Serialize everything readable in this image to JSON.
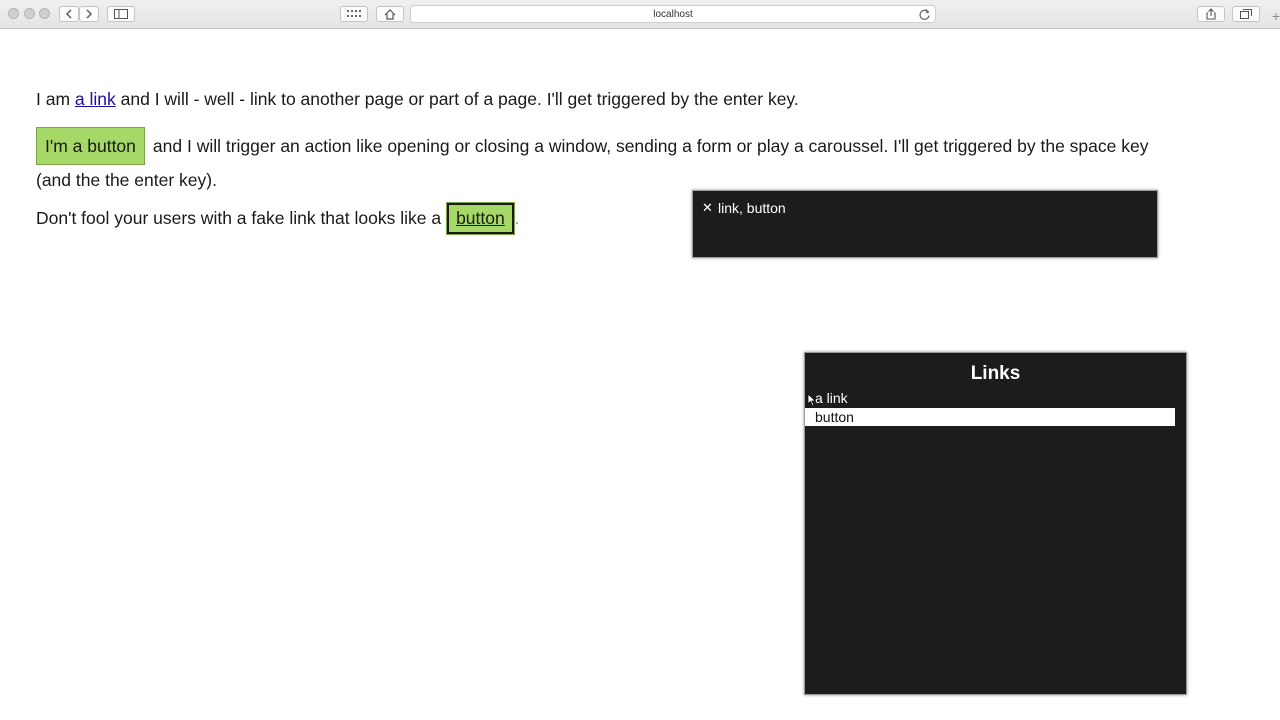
{
  "browser": {
    "url": "localhost",
    "icons": {
      "close": "close-window-dot",
      "minimize": "minimize-window-dot",
      "zoom": "zoom-window-dot",
      "back": "chevron-left-icon",
      "forward": "chevron-right-icon",
      "sidebar": "sidebar-icon",
      "top_sites": "grid-icon",
      "home": "home-icon",
      "reload": "reload-icon",
      "share": "share-icon",
      "tabs": "tabs-icon",
      "new_tab": "plus-icon"
    },
    "new_tab_glyph": "+"
  },
  "page": {
    "p1": {
      "before": "I am ",
      "link": "a link",
      "after": " and I will - well - link to another page or part of a page. I'll get triggered by the enter key."
    },
    "p2": {
      "button": "I'm a button",
      "after_line1": "and I will trigger an action like opening or closing a window, sending a form or play a caroussel. I'll get triggered by the space key",
      "line2": "(and the the enter key)."
    },
    "p3": {
      "before": "Don't fool your users with a fake link that looks like a",
      "fake_button": "button",
      "after": "."
    },
    "colors": {
      "button_green": "#a6d867",
      "link_blue": "#1a0dab",
      "panel_bg": "#1c1c1c"
    }
  },
  "voiceover": {
    "caption": {
      "close_glyph": "✕",
      "text": "link, button"
    },
    "rotor": {
      "title": "Links",
      "items": [
        "a link",
        "button"
      ],
      "selected": "button"
    }
  }
}
